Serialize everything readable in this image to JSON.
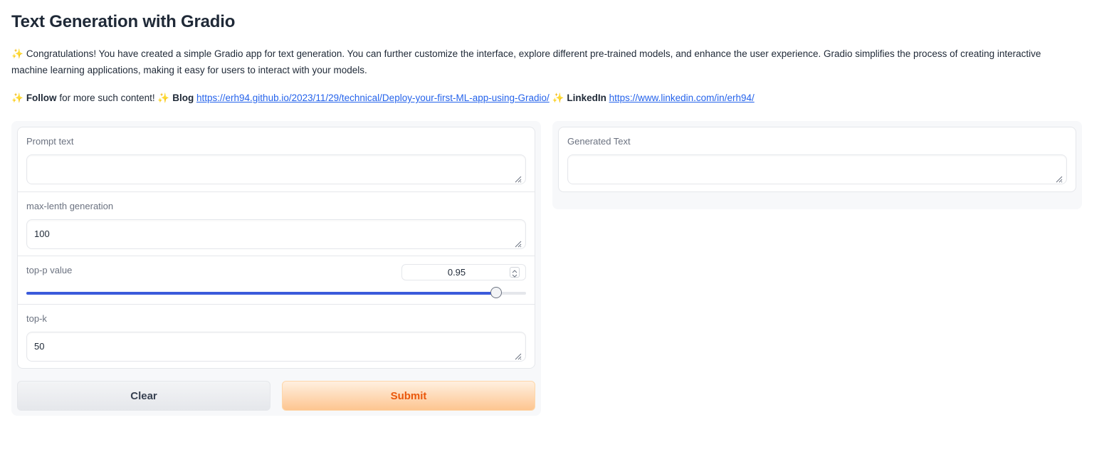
{
  "page": {
    "title": "Text Generation with Gradio",
    "description": "Congratulations! You have created a simple Gradio app for text generation. You can further customize the interface, explore different pre-trained models, and enhance the user experience. Gradio simplifies the process of creating interactive machine learning applications, making it easy for users to interact with your models.",
    "follow": {
      "follow_bold": "Follow",
      "follow_text": "for more such content!",
      "blog_bold": "Blog",
      "blog_url": "https://erh94.github.io/2023/11/29/technical/Deploy-your-first-ML-app-using-Gradio/",
      "linkedin_bold": "LinkedIn",
      "linkedin_url": "https://www.linkedin.com/in/erh94/"
    },
    "sparkle_icon": "sparkles-icon"
  },
  "inputs": {
    "prompt": {
      "label": "Prompt text",
      "value": ""
    },
    "max_length": {
      "label": "max-lenth generation",
      "value": "100"
    },
    "top_p": {
      "label": "top-p value",
      "value": "0.95",
      "fraction": 0.94
    },
    "top_k": {
      "label": "top-k",
      "value": "50"
    }
  },
  "buttons": {
    "clear": "Clear",
    "submit": "Submit"
  },
  "output": {
    "label": "Generated Text",
    "value": ""
  },
  "colors": {
    "accent": "#3b5bdb",
    "submit_text": "#ea580c",
    "link": "#2563eb"
  }
}
